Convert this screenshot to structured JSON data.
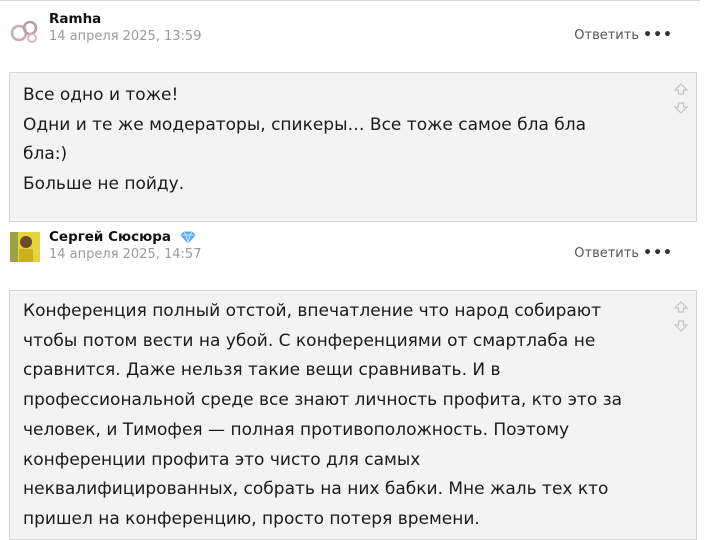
{
  "comments": [
    {
      "author": "Ramha",
      "date": "14 апреля 2025, 13:59",
      "reply_label": "Ответить",
      "more_label": "•••",
      "lines": [
        "Все одно и тоже!",
        "Одни и те же модераторы, спикеры… Все тоже самое бла бла",
        "бла:)",
        "Больше не пойду."
      ]
    },
    {
      "author": "Сергей Сюсюра",
      "badge_icon": "diamond-icon",
      "date": "14 апреля 2025, 14:57",
      "reply_label": "Ответить",
      "more_label": "•••",
      "lines": [
        "Конференция полный отстой, впечатление что народ собирают",
        "чтобы потом вести на убой. С конференциями от смартлаба не",
        "сравнится. Даже нельзя такие вещи сравнивать. И в",
        "профессиональной среде все знают личность профита, кто это за",
        "человек, и Тимофея — полная противоположность. Поэтому",
        "конференции профита это чисто для самых",
        "неквалифицированных, собрать на них бабки. Мне жаль тех кто",
        "пришел на конференцию, просто потеря времени."
      ]
    }
  ],
  "colors": {
    "bubble_bg": "#f3f3f3",
    "date": "#9a9a9a",
    "gem": "#5fb6f0"
  }
}
